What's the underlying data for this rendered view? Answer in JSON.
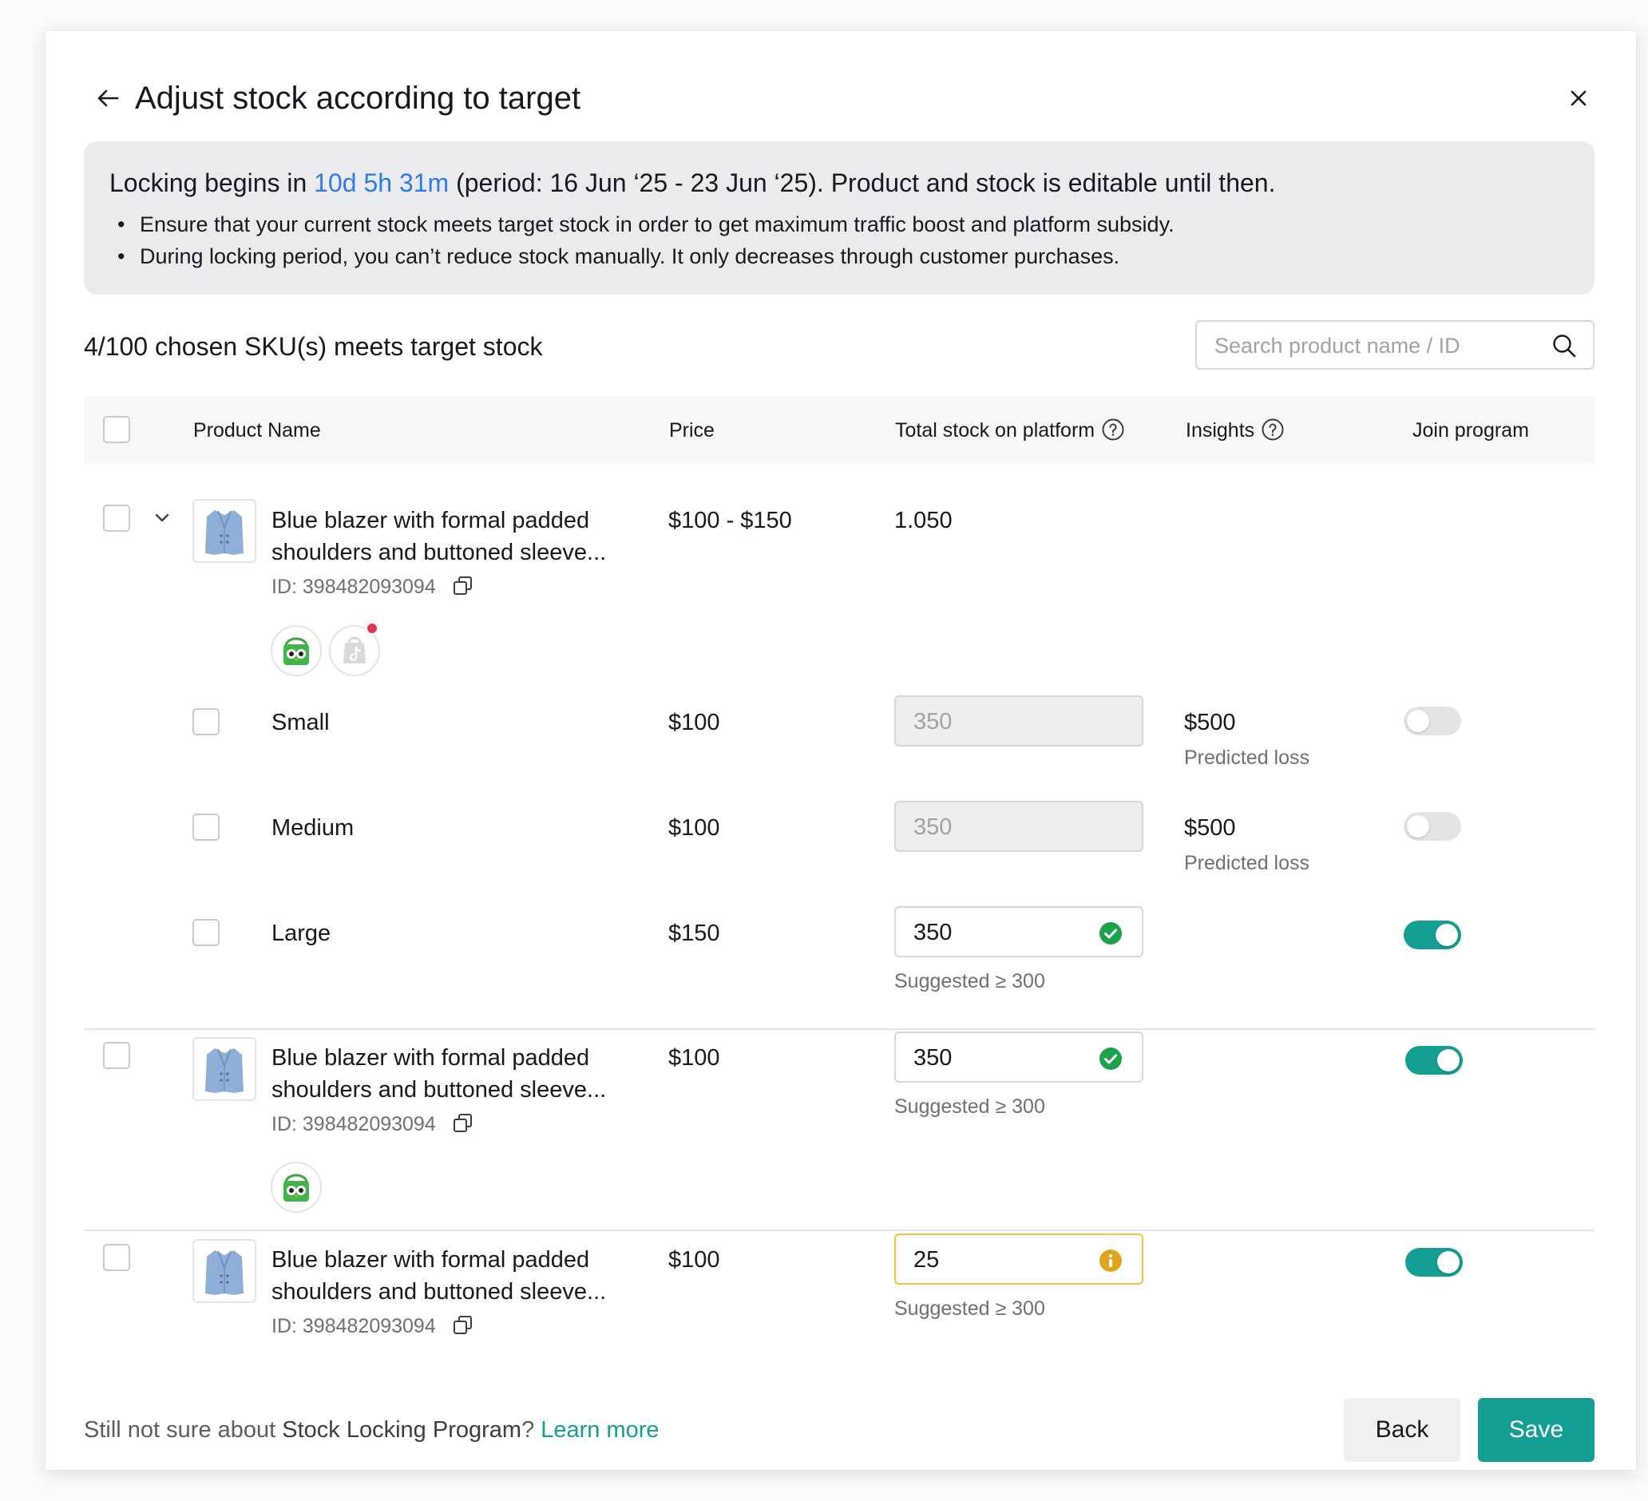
{
  "header": {
    "title": "Adjust stock according to target"
  },
  "banner": {
    "prefix": "Locking begins in ",
    "countdown": "10d 5h 31m",
    "suffix": " (period: 16 Jun ‘25 - 23 Jun ‘25). Product and stock is editable until then.",
    "bullets": [
      "Ensure that your current stock meets target stock in order to get maximum traffic boost and platform subsidy.",
      "During locking period, you can’t reduce stock manually. It only decreases through customer purchases."
    ]
  },
  "summary": "4/100 chosen SKU(s) meets target stock",
  "search": {
    "placeholder": "Search product name / ID"
  },
  "table": {
    "headers": {
      "product_name": "Product Name",
      "price": "Price",
      "total_stock": "Total stock on platform",
      "insights": "Insights",
      "join_program": "Join program"
    },
    "products": [
      {
        "name_line1": "Blue blazer with formal padded",
        "name_line2": "shoulders and buttoned sleeve...",
        "id": "ID: 398482093094",
        "price": "$100 - $150",
        "stock": "1.050",
        "stores": [
          "tokopedia-icon",
          "tiktok-shop-icon"
        ],
        "variants": [
          {
            "name": "Small",
            "price": "$100",
            "stock": "350",
            "insight_value": "$500",
            "insight_label": "Predicted loss",
            "joined": false
          },
          {
            "name": "Medium",
            "price": "$100",
            "stock": "350",
            "insight_value": "$500",
            "insight_label": "Predicted loss",
            "joined": false
          },
          {
            "name": "Large",
            "price": "$150",
            "stock": "350",
            "suggestion": "Suggested ≥ 300",
            "joined": true
          }
        ]
      },
      {
        "name_line1": "Blue blazer with formal padded",
        "name_line2": "shoulders and buttoned sleeve...",
        "id": "ID: 398482093094",
        "price": "$100",
        "stock": "350",
        "suggestion": "Suggested ≥ 300",
        "stores": [
          "tokopedia-icon"
        ],
        "joined": true
      },
      {
        "name_line1": "Blue blazer with formal padded",
        "name_line2": "shoulders and buttoned sleeve...",
        "id": "ID: 398482093094",
        "price": "$100",
        "stock": "25",
        "suggestion": "Suggested ≥ 300",
        "joined": true
      }
    ]
  },
  "footer": {
    "prefix": "Still not sure about ",
    "program": "Stock Locking Program",
    "question_mark": "? ",
    "link": "Learn more",
    "back_label": "Back",
    "save_label": "Save"
  },
  "colors": {
    "accent": "#139f93",
    "countdown": "#2b7be8",
    "success": "#1aa34a",
    "warning": "#e0a41b",
    "banner_bg": "#e9ebee"
  }
}
